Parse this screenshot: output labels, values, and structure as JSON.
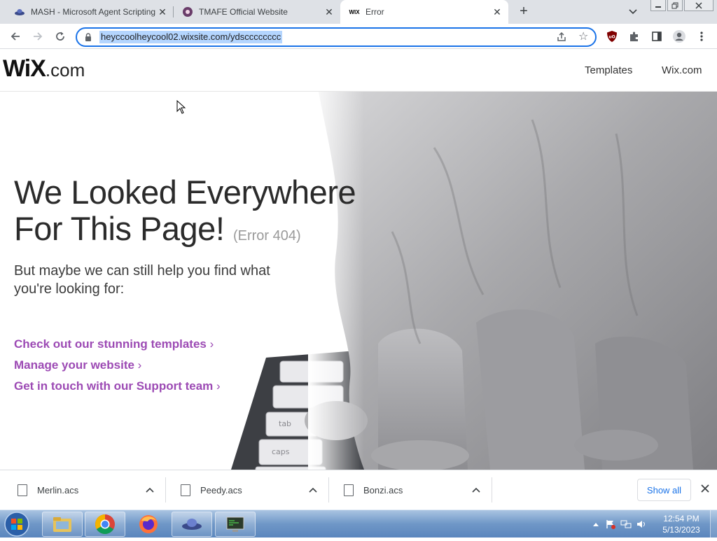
{
  "browser": {
    "tabs": [
      {
        "title": "MASH - Microsoft Agent Scripting Helper",
        "favicon": "mash-ufo-icon",
        "active": false
      },
      {
        "title": "TMAFE Official Website",
        "favicon": "tmafe-icon",
        "active": false
      },
      {
        "title": "Error",
        "favicon": "wix-icon",
        "favicon_text": "WIX",
        "active": true
      }
    ],
    "url": "heyccoolheycool02.wixsite.com/ydscccccccc"
  },
  "site": {
    "logo_main": "WiX",
    "logo_suffix": ".com",
    "nav": [
      "Templates",
      "Wix.com"
    ]
  },
  "error_page": {
    "headline_line1": "We Looked Everywhere",
    "headline_line2": "For This Page!",
    "error_code": "(Error 404)",
    "subtext": "But maybe we can still help you find what you're looking for:",
    "links": [
      "Check out our stunning templates",
      "Manage your website",
      "Get in touch with our Support team"
    ],
    "chevron": "›"
  },
  "downloads": {
    "items": [
      "Merlin.acs",
      "Peedy.acs",
      "Bonzi.acs"
    ],
    "show_all": "Show all"
  },
  "taskbar": {
    "time": "12:54 PM",
    "date": "5/13/2023"
  },
  "colors": {
    "accent": "#1a73e8",
    "link_purple": "#9c4ab4",
    "headline": "#2b2b2b"
  }
}
